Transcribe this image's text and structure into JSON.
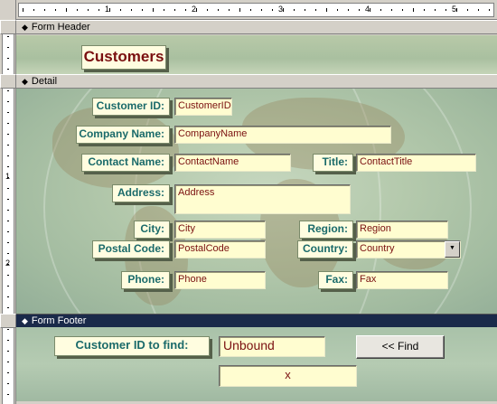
{
  "ruler": {
    "top_numbers": [
      "1",
      "2",
      "3",
      "4",
      "5"
    ],
    "left_numbers": [
      "1",
      "2"
    ]
  },
  "sections": {
    "header": "Form Header",
    "detail": "Detail",
    "footer": "Form Footer"
  },
  "header": {
    "title": "Customers"
  },
  "fields": [
    {
      "label": "Customer ID:",
      "value": "CustomerID"
    },
    {
      "label": "Company Name:",
      "value": "CompanyName"
    },
    {
      "label": "Contact Name:",
      "value": "ContactName"
    },
    {
      "label": "Title:",
      "value": "ContactTitle"
    },
    {
      "label": "Address:",
      "value": "Address"
    },
    {
      "label": "City:",
      "value": "City"
    },
    {
      "label": "Region:",
      "value": "Region"
    },
    {
      "label": "Postal Code:",
      "value": "PostalCode"
    },
    {
      "label": "Country:",
      "value": "Country"
    },
    {
      "label": "Phone:",
      "value": "Phone"
    },
    {
      "label": "Fax:",
      "value": "Fax"
    }
  ],
  "footer": {
    "find_label": "Customer ID to find:",
    "find_value": "Unbound",
    "find_button": "<< Find",
    "result_text": "x"
  },
  "colors": {
    "label_text": "#1a6a6a",
    "field_text": "#7a1010",
    "field_bg": "#fffdd0",
    "footer_bar": "#1a2a4a"
  }
}
